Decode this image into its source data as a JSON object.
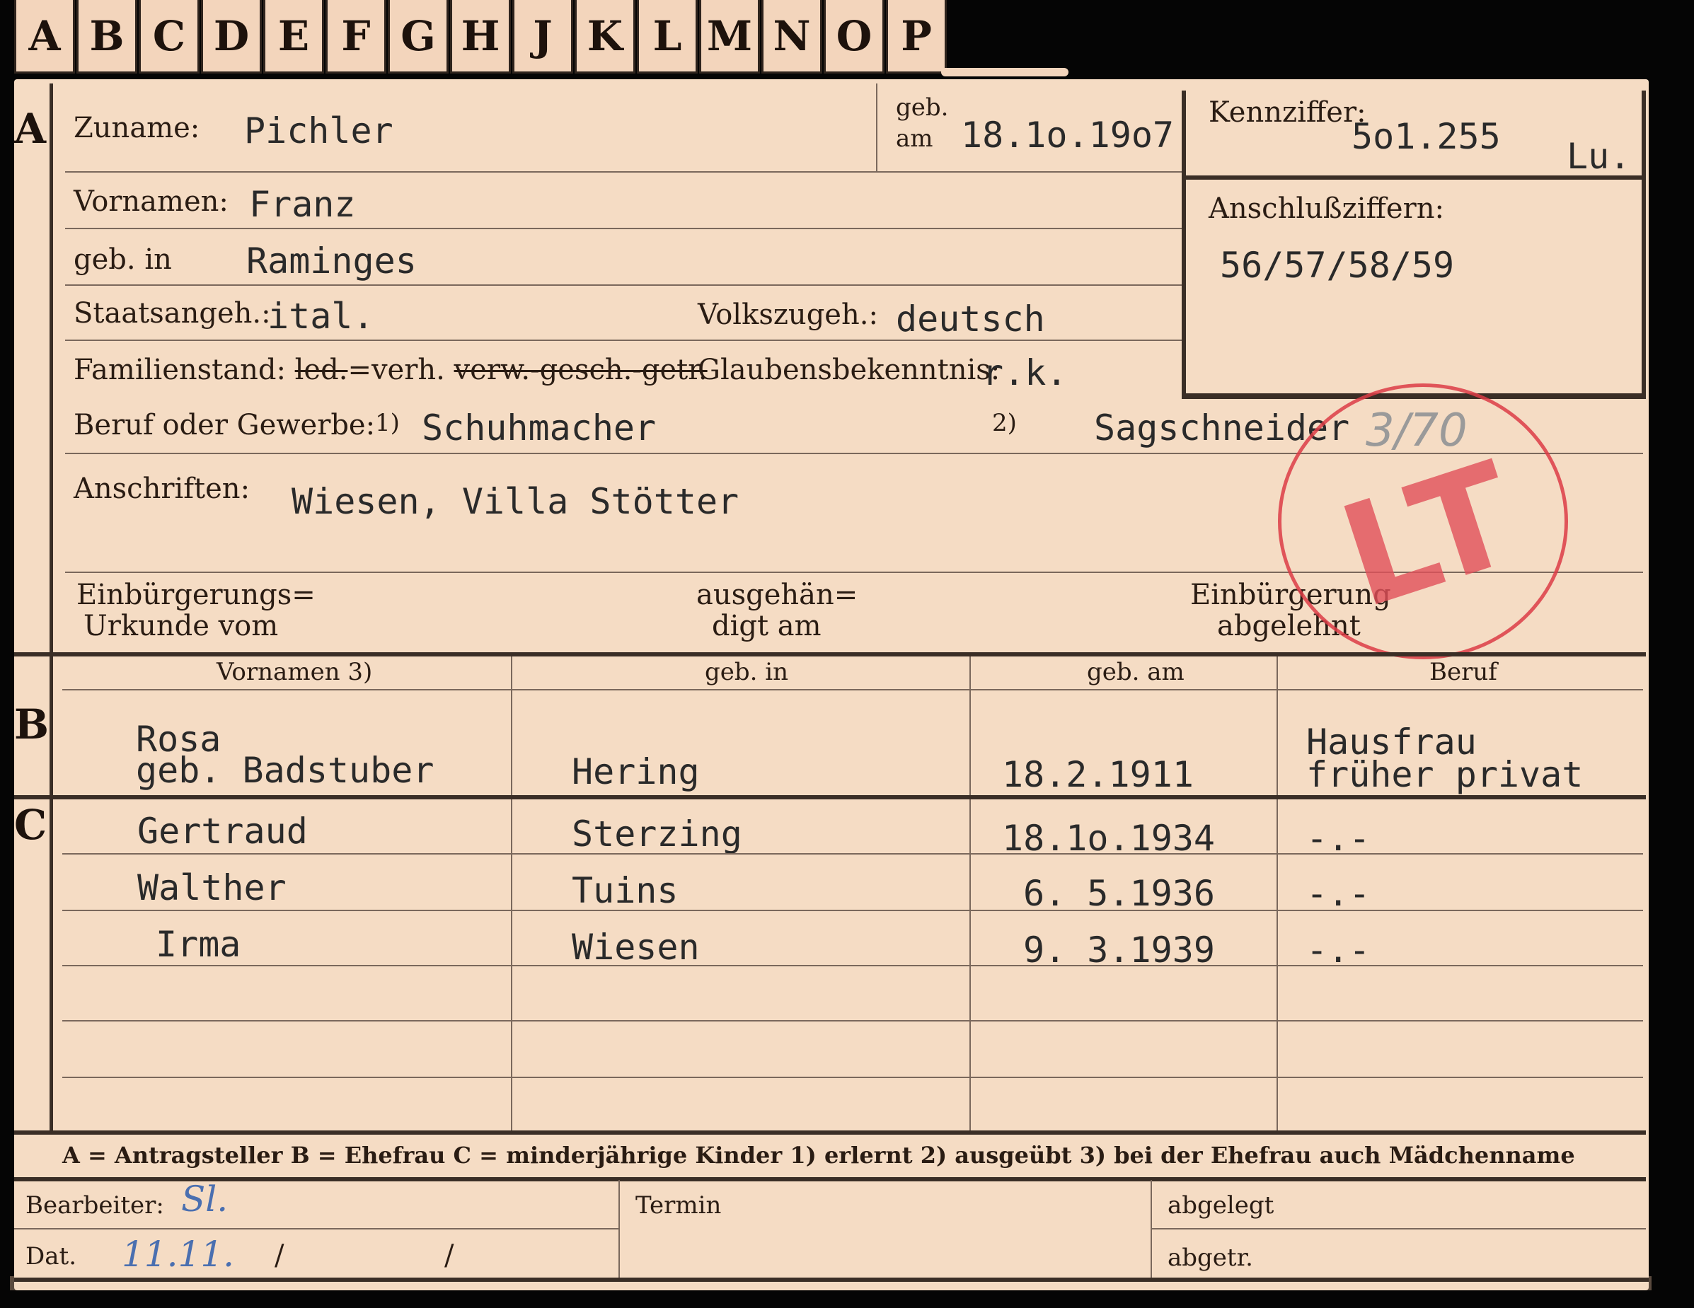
{
  "tabs": [
    "A",
    "B",
    "C",
    "D",
    "E",
    "F",
    "G",
    "H",
    "J",
    "K",
    "L",
    "M",
    "N",
    "O",
    "P"
  ],
  "sections": {
    "a": "A",
    "b": "B",
    "c": "C"
  },
  "a": {
    "zuname_label": "Zuname:",
    "zuname": "Pichler",
    "geb_label_1": "geb.",
    "geb_label_2": "am",
    "geb_am": "18.1o.19o7",
    "kennziffer_label": "Kennziffer:",
    "kennziffer": "5o1.255",
    "kennziffer_suffix": "Lu.",
    "anschluss_label": "Anschlußziffern:",
    "anschluss": "56/57/58/59",
    "vornamen_label": "Vornamen:",
    "vornamen": "Franz",
    "geb_in_label": "geb. in",
    "geb_in": "Raminges",
    "staatsangeh_label": "Staatsangeh.:",
    "staatsangeh": "ital.",
    "volkszugeh_label": "Volkszugeh.:",
    "volkszugeh": "deutsch",
    "familienstand_label": "Familienstand:",
    "fam_led": "led.",
    "fam_sep": "=",
    "fam_verh": "verh.",
    "fam_struck": "verw.-gesch.-getr.",
    "glauben_label": "Glaubensbekenntnis:",
    "glauben": "r.k.",
    "beruf_label": "Beruf oder Gewerbe:",
    "beruf_note1": "1)",
    "beruf1": "Schuhmacher",
    "beruf_note2": "2)",
    "beruf2": "Sagschneider",
    "pencil_note": "3/70",
    "anschriften_label": "Anschriften:",
    "anschriften": "Wiesen, Villa Stötter",
    "einb_urk_1": "Einbürgerungs=",
    "einb_urk_2": "Urkunde vom",
    "ausgeh_1": "ausgehän=",
    "ausgeh_2": "digt am",
    "einb_abg_1": "Einbürgerung",
    "einb_abg_2": "abgelehnt",
    "stamp": "LT"
  },
  "table": {
    "headers": [
      "Vornamen 3)",
      "geb. in",
      "geb. am",
      "Beruf"
    ],
    "wife": {
      "name_1": "Rosa",
      "name_2": "geb. Badstuber",
      "place": "Hering",
      "date": "18.2.1911",
      "job_1": "Hausfrau",
      "job_2": "früher privat"
    },
    "children": [
      {
        "name": "Gertraud",
        "place": "Sterzing",
        "date": "18.1o.1934",
        "job": "-.-"
      },
      {
        "name": "Walther",
        "place": "Tuins",
        "date": "6. 5.1936",
        "job": "-.-"
      },
      {
        "name": "Irma",
        "place": "Wiesen",
        "date": "9. 3.1939",
        "job": "-.-"
      }
    ]
  },
  "legend": "A = Antragsteller   B = Ehefrau   C = minderjährige Kinder   1) erlernt   2) ausgeübt   3) bei der Ehefrau auch Mädchenname",
  "footer": {
    "bearbeiter_label": "Bearbeiter:",
    "bearbeiter": "Sl.",
    "termin_label": "Termin",
    "abgelegt_label": "abgelegt",
    "dat_label": "Dat.",
    "dat": "11.11.",
    "slash1": "/",
    "slash2": "/",
    "abgetr_label": "abgetr."
  },
  "colors": {
    "paper": "#f5dcc4",
    "ink": "#2a1c13",
    "stamp": "#dc3c46",
    "background": "#050505"
  }
}
